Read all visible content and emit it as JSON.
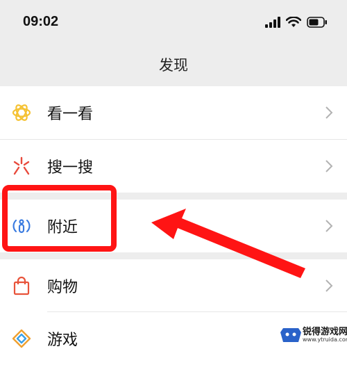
{
  "status_bar": {
    "time": "09:02",
    "icons": [
      "signal-icon",
      "wifi-icon",
      "battery-icon"
    ]
  },
  "navbar": {
    "title": "发现"
  },
  "menu": {
    "items": [
      {
        "label": "看一看",
        "icon": "look-icon",
        "color": "#f5c233"
      },
      {
        "label": "搜一搜",
        "icon": "search-burst-icon",
        "color": "#e84a3c"
      },
      {
        "label": "附近",
        "icon": "nearby-icon",
        "color": "#3a7be0"
      },
      {
        "label": "购物",
        "icon": "shopping-bag-icon",
        "color": "#e8533a"
      },
      {
        "label": "游戏",
        "icon": "game-icon",
        "color": "#f0a02f"
      }
    ]
  },
  "annotation": {
    "highlight_color": "#ff1414",
    "highlighted_item": "附近"
  },
  "watermark": {
    "text": "锐得游戏网",
    "url": "www.ytruida.com"
  }
}
